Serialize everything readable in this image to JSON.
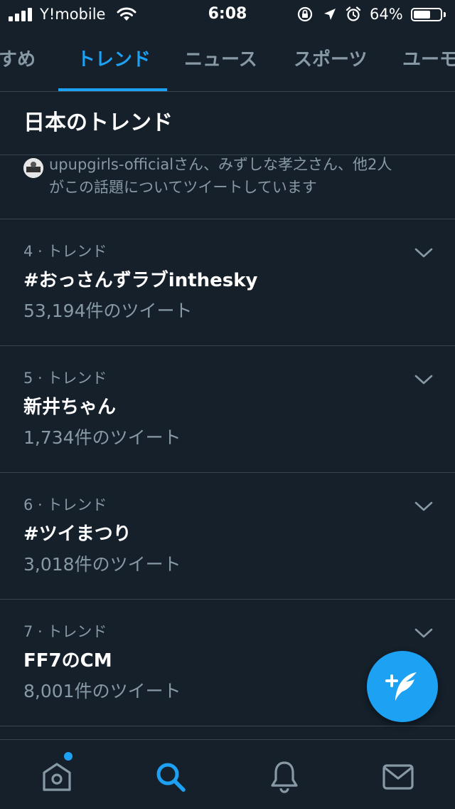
{
  "status_bar": {
    "carrier": "Y!mobile",
    "time": "6:08",
    "battery_percent": "64%",
    "battery_level": 0.64
  },
  "tabs": [
    {
      "label": "すめ"
    },
    {
      "label": "トレンド"
    },
    {
      "label": "ニュース"
    },
    {
      "label": "スポーツ"
    },
    {
      "label": "ユーモ"
    }
  ],
  "section": {
    "title": "日本のトレンド"
  },
  "context": {
    "line1": "upupgirls-officialさん、みずしな孝之さん、他2人",
    "line2": "がこの話題についてツイートしています"
  },
  "trends": [
    {
      "rank": "4 · トレンド",
      "name": "#おっさんずラブinthesky",
      "count": "53,194件のツイート"
    },
    {
      "rank": "5 · トレンド",
      "name": "新井ちゃん",
      "count": "1,734件のツイート"
    },
    {
      "rank": "6 · トレンド",
      "name": "#ツイまつり",
      "count": "3,018件のツイート"
    },
    {
      "rank": "7 · トレンド",
      "name": "FF7のCM",
      "count": "8,001件のツイート"
    }
  ],
  "colors": {
    "background": "#15202b",
    "accent": "#1da1f2",
    "secondary_text": "#8899a6",
    "divider": "#38444d"
  },
  "icons": {
    "nav": [
      "home-icon",
      "search-icon",
      "notifications-icon",
      "messages-icon"
    ],
    "fab": "compose-tweet-icon",
    "trend_menu": "chevron-down-icon"
  }
}
